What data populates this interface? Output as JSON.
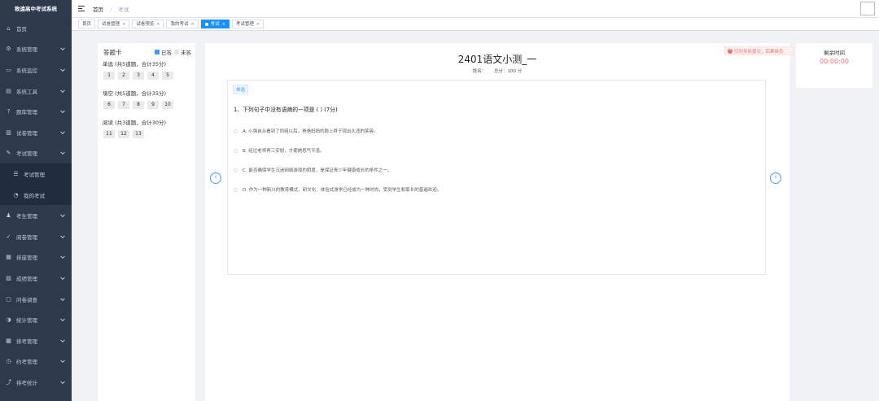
{
  "app": {
    "title": "致遠高中考试系统"
  },
  "sidebar": {
    "items": [
      {
        "label": "首页",
        "icon": "home-icon",
        "glyph": "⌂",
        "arrow": false
      },
      {
        "label": "系统管理",
        "icon": "gear-icon",
        "glyph": "⚙",
        "arrow": true
      },
      {
        "label": "系统监控",
        "icon": "monitor-icon",
        "glyph": "▭",
        "arrow": true
      },
      {
        "label": "系统工具",
        "icon": "tool-icon",
        "glyph": "▤",
        "arrow": true
      },
      {
        "label": "题库管理",
        "icon": "question-icon",
        "glyph": "?",
        "arrow": true
      },
      {
        "label": "试卷管理",
        "icon": "document-icon",
        "glyph": "▥",
        "arrow": true
      },
      {
        "label": "考试管理",
        "icon": "exam-icon",
        "glyph": "✎",
        "arrow": true
      },
      {
        "label": "考试管理",
        "icon": "exam-sub-icon",
        "glyph": "☰",
        "arrow": false,
        "sub": true
      },
      {
        "label": "我的考试",
        "icon": "my-exam-icon",
        "glyph": "◔",
        "arrow": false,
        "sub": true
      },
      {
        "label": "考生管理",
        "icon": "user-icon",
        "glyph": "♟",
        "arrow": true
      },
      {
        "label": "阅卷管理",
        "icon": "check-icon",
        "glyph": "✓",
        "arrow": true
      },
      {
        "label": "排座管理",
        "icon": "seat-icon",
        "glyph": "▦",
        "arrow": true
      },
      {
        "label": "成绩管理",
        "icon": "score-icon",
        "glyph": "▧",
        "arrow": true
      },
      {
        "label": "问卷调查",
        "icon": "survey-icon",
        "glyph": "▢",
        "arrow": true
      },
      {
        "label": "统计管理",
        "icon": "stats-icon",
        "glyph": "◑",
        "arrow": true
      },
      {
        "label": "排考管理",
        "icon": "schedule-icon",
        "glyph": "▩",
        "arrow": true
      },
      {
        "label": "约考管理",
        "icon": "appointment-icon",
        "glyph": "◷",
        "arrow": true
      },
      {
        "label": "排考统计",
        "icon": "chart-icon",
        "glyph": "⤴",
        "arrow": true
      }
    ]
  },
  "header": {
    "breadcrumb": {
      "home": "首页",
      "separator": "/",
      "current": "考试"
    }
  },
  "tags": [
    {
      "label": "首页",
      "active": false,
      "closable": false
    },
    {
      "label": "试卷管理",
      "active": false,
      "closable": true
    },
    {
      "label": "试卷预览",
      "active": false,
      "closable": true
    },
    {
      "label": "我的考试",
      "active": false,
      "closable": true
    },
    {
      "label": "考试",
      "active": true,
      "closable": true
    },
    {
      "label": "考试管理",
      "active": false,
      "closable": true
    }
  ],
  "answer_card": {
    "title": "答题卡",
    "legend_done": "已答",
    "legend_todo": "未答",
    "sections": [
      {
        "title": "单选 (共5道题，合计35分)",
        "numbers": [
          "1",
          "2",
          "3",
          "4",
          "5"
        ]
      },
      {
        "title": "填空 (共5道题，合计35分)",
        "numbers": [
          "6",
          "7",
          "8",
          "9",
          "10"
        ]
      },
      {
        "title": "阅读 (共3道题，合计30分)",
        "numbers": [
          "11",
          "12",
          "13"
        ]
      }
    ]
  },
  "paper": {
    "title": "2401语文小测_一",
    "name_label": "姓名：",
    "total_label": "总分：100 分"
  },
  "question": {
    "type": "单选",
    "stem": "1、下列句子中没有语病的一项是 ( ) (7分)",
    "options": [
      "A. 小强自从看到了同组以后，爸爸妈妈的脸上终于现出久违的笑容。",
      "B. 经过老师再三安慰，才使她怒气平息。",
      "C. 能否确保学生沉迷网络游戏的阴度，是保证青少年健康成长的条件之一。",
      "D. 作为一种新兴的教育模式，研文化、体验式游学已经成为一种时尚，受到学生和家长的普遍欢迎。"
    ]
  },
  "timer": {
    "label": "剩余时间",
    "value": "00:00:00"
  },
  "warning": {
    "text": "切勿多处提交，后果自负"
  },
  "colors": {
    "sidebar_bg": "#2d3a4b",
    "accent": "#409eff",
    "active_tag": "#1890ff",
    "danger": "#f56c6c"
  }
}
